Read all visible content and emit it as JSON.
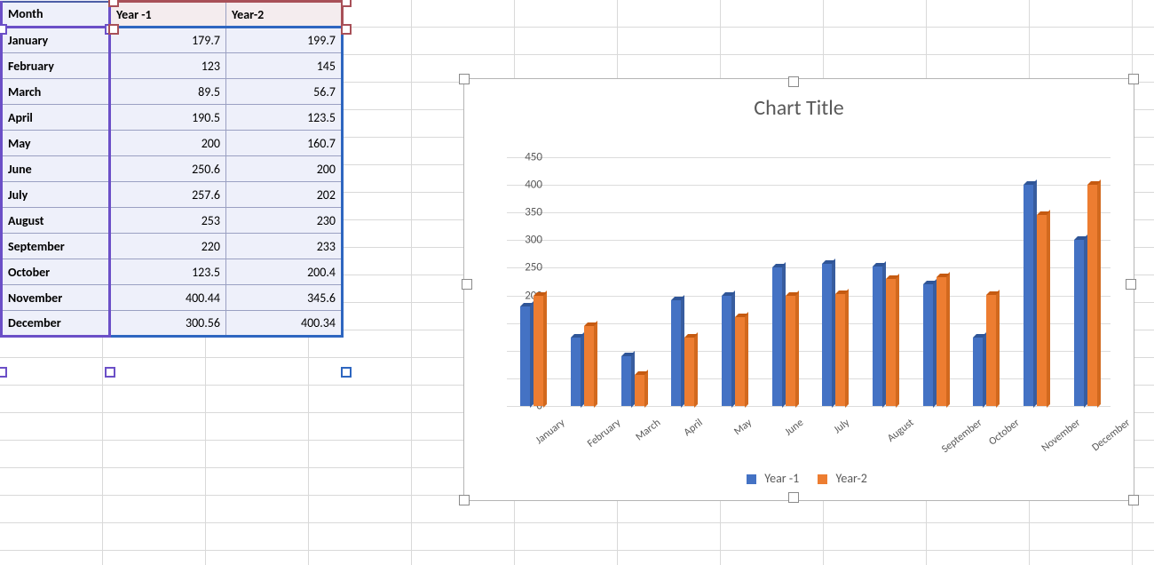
{
  "table": {
    "headers": [
      "Month",
      "Year -1",
      "Year-2"
    ],
    "rows": [
      {
        "month": "January",
        "y1": "179.7",
        "y2": "199.7"
      },
      {
        "month": "February",
        "y1": "123",
        "y2": "145"
      },
      {
        "month": "March",
        "y1": "89.5",
        "y2": "56.7"
      },
      {
        "month": "April",
        "y1": "190.5",
        "y2": "123.5"
      },
      {
        "month": "May",
        "y1": "200",
        "y2": "160.7"
      },
      {
        "month": "June",
        "y1": "250.6",
        "y2": "200"
      },
      {
        "month": "July",
        "y1": "257.6",
        "y2": "202"
      },
      {
        "month": "August",
        "y1": "253",
        "y2": "230"
      },
      {
        "month": "September",
        "y1": "220",
        "y2": "233"
      },
      {
        "month": "October",
        "y1": "123.5",
        "y2": "200.4"
      },
      {
        "month": "November",
        "y1": "400.44",
        "y2": "345.6"
      },
      {
        "month": "December",
        "y1": "300.56",
        "y2": "400.34"
      }
    ]
  },
  "chart_data": {
    "type": "bar",
    "title": "Chart Title",
    "xlabel": "",
    "ylabel": "",
    "ylim": [
      0,
      450
    ],
    "ytick_step": 50,
    "categories": [
      "January",
      "February",
      "March",
      "April",
      "May",
      "June",
      "July",
      "August",
      "September",
      "October",
      "November",
      "December"
    ],
    "series": [
      {
        "name": "Year -1",
        "color": "#4472c4",
        "values": [
          179.7,
          123,
          89.5,
          190.5,
          200,
          250.6,
          257.6,
          253,
          220,
          123.5,
          400.44,
          300.56
        ]
      },
      {
        "name": "Year-2",
        "color": "#ed7d31",
        "values": [
          199.7,
          145,
          56.7,
          123.5,
          160.7,
          200,
          202,
          230,
          233,
          200.4,
          345.6,
          400.34
        ]
      }
    ]
  }
}
